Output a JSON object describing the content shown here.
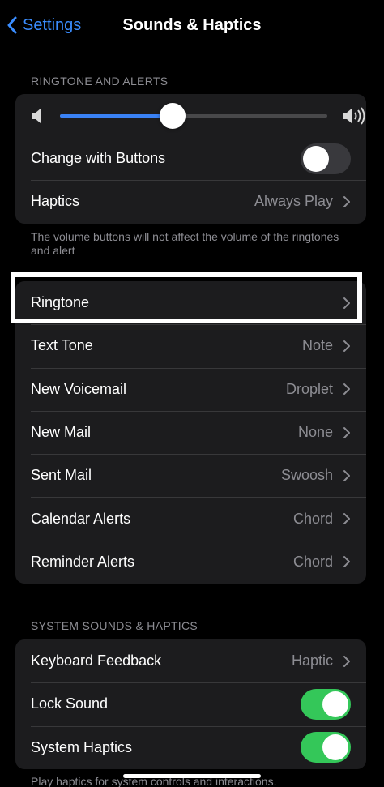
{
  "nav": {
    "back_label": "Settings",
    "title": "Sounds & Haptics"
  },
  "ringtone_section": {
    "header": "RINGTONE AND ALERTS",
    "volume": {
      "level": 0.42
    },
    "change_with_buttons": {
      "label": "Change with Buttons",
      "on": false
    },
    "haptics": {
      "label": "Haptics",
      "value": "Always Play"
    },
    "footer": "The volume buttons will not affect the volume of the ringtones and alert"
  },
  "sounds": [
    {
      "label": "Ringtone",
      "value": ""
    },
    {
      "label": "Text Tone",
      "value": "Note"
    },
    {
      "label": "New Voicemail",
      "value": "Droplet"
    },
    {
      "label": "New Mail",
      "value": "None"
    },
    {
      "label": "Sent Mail",
      "value": "Swoosh"
    },
    {
      "label": "Calendar Alerts",
      "value": "Chord"
    },
    {
      "label": "Reminder Alerts",
      "value": "Chord"
    }
  ],
  "system_section": {
    "header": "SYSTEM SOUNDS & HAPTICS",
    "keyboard_feedback": {
      "label": "Keyboard Feedback",
      "value": "Haptic"
    },
    "lock_sound": {
      "label": "Lock Sound",
      "on": true
    },
    "system_haptics": {
      "label": "System Haptics",
      "on": true
    },
    "footer": "Play haptics for system controls and interactions."
  },
  "colors": {
    "accent": "#3a8dff",
    "toggle_on": "#34c759",
    "slider_fill": "#3a82f6"
  }
}
